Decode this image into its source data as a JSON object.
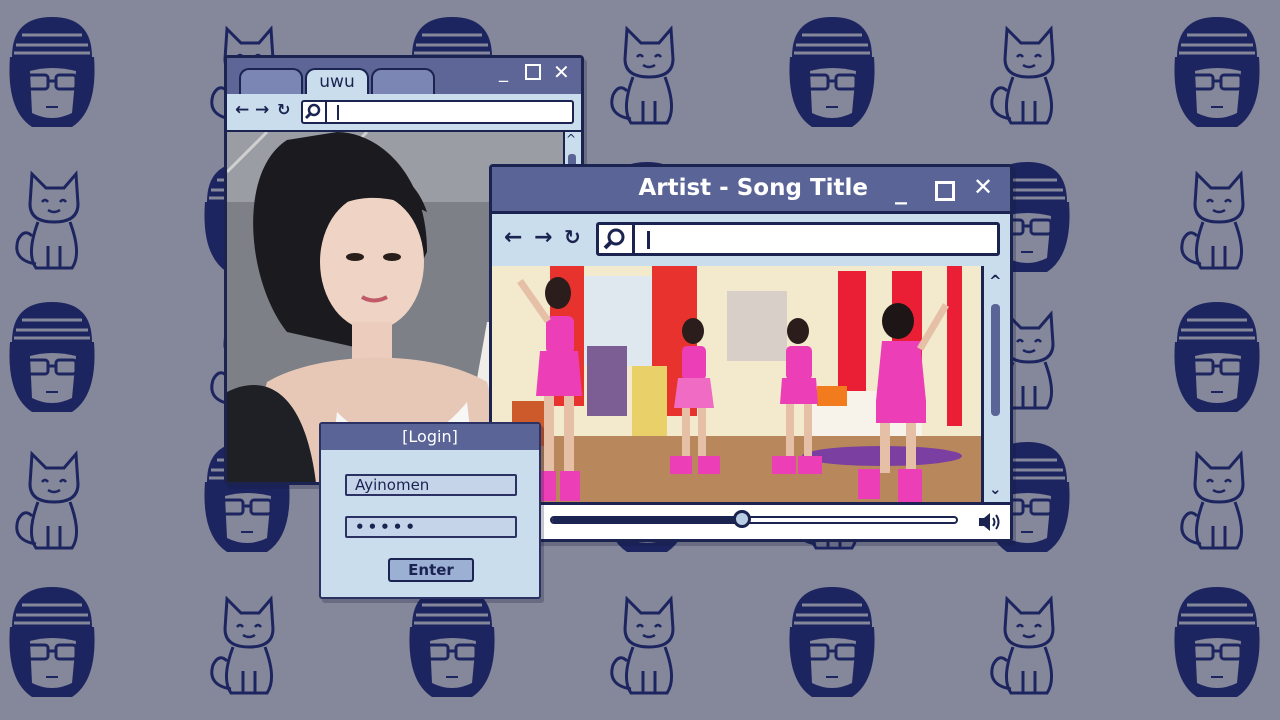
{
  "colors": {
    "background": "#85879a",
    "pattern_ink": "#1d2560",
    "titlebar": "#5a6496",
    "window_body": "#c9ddec",
    "border": "#1b2350",
    "dancer_pink": "#ec3fb7"
  },
  "browser_small": {
    "tab_active": "uwu",
    "tabs": [
      "",
      "uwu",
      ""
    ],
    "address_value": "|",
    "icons": [
      "back-arrow-icon",
      "forward-arrow-icon",
      "refresh-icon",
      "search-icon",
      "minimize-icon",
      "maximize-icon",
      "close-icon"
    ]
  },
  "player_window": {
    "title": "Artist - Song Title",
    "address_value": "|",
    "progress": 0.47,
    "icons": [
      "back-arrow-icon",
      "forward-arrow-icon",
      "refresh-icon",
      "search-icon",
      "play-icon",
      "volume-icon",
      "scroll-up-icon",
      "scroll-down-icon"
    ]
  },
  "login": {
    "title": "[Login]",
    "username": "Ayinomen",
    "password_mask": "•••••",
    "button_label": "Enter"
  }
}
